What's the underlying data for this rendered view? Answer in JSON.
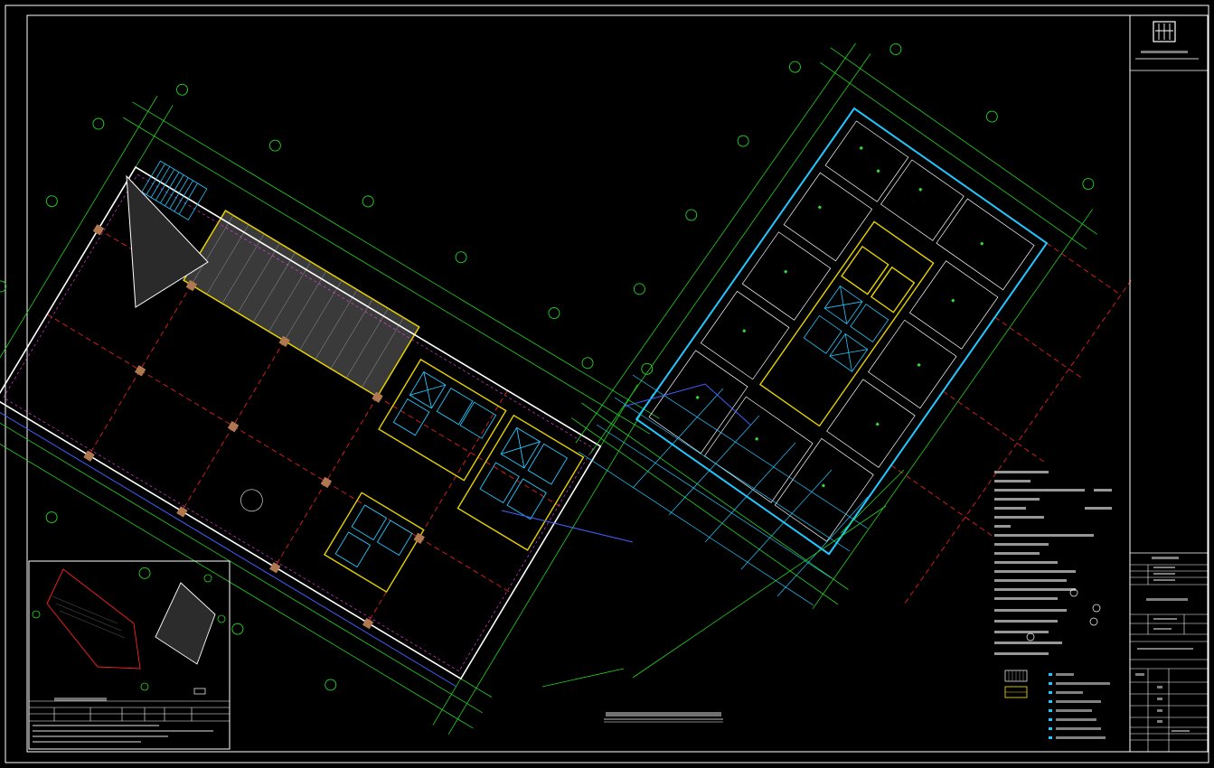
{
  "drawing": {
    "title": "",
    "colors": {
      "background": "#000000",
      "frame": "#ffffff",
      "axis": "#22d422",
      "dim": "#33dd33",
      "wall": "#ffffff",
      "hatch": "#9a9a9a",
      "red_dash": "#ff2020",
      "cyan": "#22c8ff",
      "yellow": "#e6d200",
      "magenta": "#ff40ff",
      "blue": "#4060ff"
    }
  },
  "title_block": {
    "logo_icon": "firm-logo-icon",
    "rows": 14
  },
  "key_plan": {
    "label": ""
  },
  "notes": {
    "line_count": 20,
    "legend_count": 8
  }
}
